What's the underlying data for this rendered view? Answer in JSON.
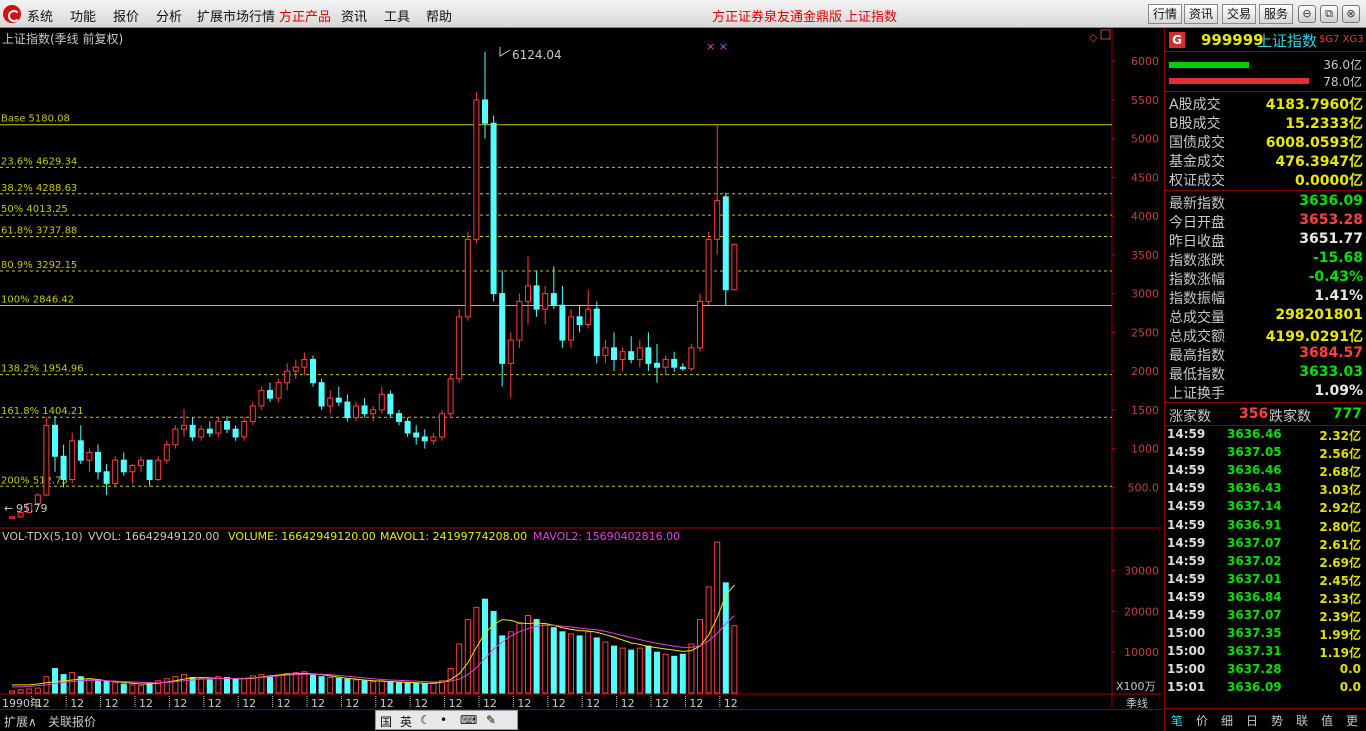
{
  "menu": {
    "items": [
      "系统",
      "功能",
      "报价",
      "分析",
      "扩展市场行情",
      "方正产品",
      "资讯",
      "工具",
      "帮助"
    ],
    "promo1": "方正证券泉友通金鼎版",
    "promo2": "上证指数",
    "right_buttons": [
      "行情",
      "资讯",
      "交易",
      "服务"
    ]
  },
  "chart": {
    "title": "上证指数(季线 前复权)",
    "high_label": "6124.04",
    "low_label": "95.79",
    "marker": "× ×",
    "fib_levels": [
      {
        "label": "Base 5180.08",
        "value": 5180.08,
        "solid": true
      },
      {
        "label": "23.6% 4629.34",
        "value": 4629.34,
        "solid": false
      },
      {
        "label": "38.2% 4288.63",
        "value": 4288.63,
        "solid": false
      },
      {
        "label": "50% 4013.25",
        "value": 4013.25,
        "solid": false
      },
      {
        "label": "61.8% 3737.88",
        "value": 3737.88,
        "solid": false
      },
      {
        "label": "80.9% 3292.15",
        "value": 3292.15,
        "solid": false
      },
      {
        "label": "100% 2846.42",
        "value": 2846.42,
        "solid": true
      },
      {
        "label": "138.2% 1954.96",
        "value": 1954.96,
        "solid": false
      },
      {
        "label": "161.8% 1404.21",
        "value": 1404.21,
        "solid": false
      },
      {
        "label": "200% 512.75",
        "value": 512.75,
        "solid": false
      }
    ],
    "price_ticks": [
      "6000",
      "5500",
      "5000",
      "4500",
      "4000",
      "3500",
      "3000",
      "2500",
      "2000",
      "1500",
      "1000",
      "500.0"
    ],
    "vol_ticks": [
      "30000",
      "20000",
      "10000"
    ],
    "vol_unit": "X100万",
    "x_start_label": "1990年",
    "x_tick_label": "12",
    "period_label": "季线"
  },
  "chart_data": {
    "type": "candlestick",
    "ylim": [
      0,
      6300
    ],
    "vol_ylim": [
      0,
      38000
    ],
    "candles": [
      [
        100,
        120,
        95,
        118,
        5
      ],
      [
        118,
        180,
        115,
        175,
        8
      ],
      [
        175,
        300,
        170,
        290,
        10
      ],
      [
        290,
        420,
        280,
        400,
        12
      ],
      [
        400,
        1400,
        380,
        1300,
        40
      ],
      [
        1300,
        1420,
        700,
        900,
        60
      ],
      [
        900,
        1050,
        500,
        600,
        45
      ],
      [
        600,
        1200,
        550,
        1100,
        50
      ],
      [
        1100,
        1300,
        800,
        850,
        40
      ],
      [
        850,
        1000,
        700,
        950,
        35
      ],
      [
        950,
        1050,
        600,
        700,
        30
      ],
      [
        700,
        800,
        400,
        550,
        28
      ],
      [
        550,
        900,
        500,
        850,
        25
      ],
      [
        850,
        950,
        650,
        700,
        22
      ],
      [
        700,
        800,
        550,
        780,
        20
      ],
      [
        780,
        900,
        700,
        850,
        18
      ],
      [
        850,
        800,
        512,
        600,
        25
      ],
      [
        600,
        900,
        580,
        850,
        30
      ],
      [
        850,
        1100,
        800,
        1050,
        35
      ],
      [
        1050,
        1300,
        1000,
        1250,
        40
      ],
      [
        1250,
        1510,
        1150,
        1300,
        45
      ],
      [
        1300,
        1400,
        1100,
        1150,
        38
      ],
      [
        1150,
        1300,
        1100,
        1250,
        35
      ],
      [
        1250,
        1350,
        1150,
        1200,
        32
      ],
      [
        1200,
        1400,
        1150,
        1350,
        40
      ],
      [
        1350,
        1420,
        1200,
        1250,
        38
      ],
      [
        1250,
        1300,
        1100,
        1150,
        34
      ],
      [
        1150,
        1400,
        1100,
        1350,
        36
      ],
      [
        1350,
        1600,
        1300,
        1550,
        42
      ],
      [
        1550,
        1800,
        1500,
        1750,
        45
      ],
      [
        1750,
        1850,
        1600,
        1650,
        40
      ],
      [
        1650,
        1900,
        1600,
        1850,
        44
      ],
      [
        1850,
        2100,
        1750,
        2000,
        48
      ],
      [
        2000,
        2150,
        1900,
        2050,
        50
      ],
      [
        2050,
        2240,
        1950,
        2150,
        52
      ],
      [
        2150,
        2200,
        1800,
        1850,
        45
      ],
      [
        1850,
        1900,
        1500,
        1550,
        40
      ],
      [
        1550,
        1750,
        1450,
        1650,
        38
      ],
      [
        1650,
        1800,
        1550,
        1600,
        36
      ],
      [
        1600,
        1700,
        1350,
        1400,
        34
      ],
      [
        1400,
        1600,
        1350,
        1550,
        32
      ],
      [
        1550,
        1650,
        1400,
        1450,
        30
      ],
      [
        1450,
        1550,
        1350,
        1500,
        28
      ],
      [
        1500,
        1800,
        1450,
        1700,
        30
      ],
      [
        1700,
        1750,
        1400,
        1450,
        28
      ],
      [
        1450,
        1500,
        1300,
        1350,
        26
      ],
      [
        1350,
        1400,
        1150,
        1200,
        25
      ],
      [
        1200,
        1300,
        1050,
        1150,
        24
      ],
      [
        1150,
        1250,
        1000,
        1100,
        22
      ],
      [
        1100,
        1200,
        1050,
        1150,
        24
      ],
      [
        1150,
        1500,
        1100,
        1450,
        30
      ],
      [
        1450,
        1950,
        1400,
        1900,
        60
      ],
      [
        1900,
        2800,
        1850,
        2700,
        120
      ],
      [
        2700,
        3800,
        2650,
        3700,
        180
      ],
      [
        3700,
        5600,
        3650,
        5500,
        210
      ],
      [
        5500,
        6124,
        5000,
        5200,
        230
      ],
      [
        5200,
        5300,
        2900,
        3000,
        200
      ],
      [
        3000,
        3300,
        1800,
        2100,
        140
      ],
      [
        2100,
        2500,
        1650,
        2400,
        150
      ],
      [
        2400,
        3000,
        2300,
        2900,
        170
      ],
      [
        2900,
        3480,
        2600,
        3100,
        190
      ],
      [
        3100,
        3300,
        2700,
        2800,
        180
      ],
      [
        2800,
        3100,
        2600,
        3000,
        170
      ],
      [
        3000,
        3350,
        2800,
        2850,
        160
      ],
      [
        2850,
        3100,
        2300,
        2400,
        150
      ],
      [
        2400,
        2800,
        2300,
        2700,
        145
      ],
      [
        2700,
        2850,
        2500,
        2600,
        140
      ],
      [
        2600,
        3050,
        2550,
        2800,
        150
      ],
      [
        2800,
        2900,
        2100,
        2200,
        135
      ],
      [
        2200,
        2400,
        2100,
        2300,
        125
      ],
      [
        2300,
        2500,
        2000,
        2150,
        115
      ],
      [
        2150,
        2300,
        2000,
        2250,
        110
      ],
      [
        2250,
        2450,
        2100,
        2150,
        105
      ],
      [
        2150,
        2400,
        2050,
        2300,
        110
      ],
      [
        2300,
        2500,
        2000,
        2100,
        115
      ],
      [
        2100,
        2350,
        1850,
        2050,
        100
      ],
      [
        2050,
        2200,
        1950,
        2150,
        95
      ],
      [
        2150,
        2250,
        1990,
        2050,
        90
      ],
      [
        2050,
        2100,
        2000,
        2030,
        95
      ],
      [
        2030,
        2350,
        2000,
        2300,
        120
      ],
      [
        2300,
        3000,
        2250,
        2900,
        180
      ],
      [
        2900,
        3800,
        2850,
        3700,
        260
      ],
      [
        3700,
        5180,
        3500,
        4200,
        370
      ],
      [
        4250,
        4300,
        2850,
        3050,
        270
      ],
      [
        3050,
        3650,
        3050,
        3636,
        165
      ]
    ],
    "mavol1": [
      20,
      20,
      20,
      22,
      25,
      28,
      30,
      32,
      34,
      35,
      33,
      30,
      28,
      26,
      24,
      22,
      22,
      24,
      27,
      30,
      34,
      37,
      38,
      37,
      36,
      36,
      35,
      35,
      36,
      39,
      42,
      44,
      46,
      47,
      48,
      47,
      45,
      42,
      39,
      36,
      34,
      32,
      30,
      29,
      28,
      27,
      26,
      25,
      24,
      24,
      26,
      33,
      47,
      74,
      112,
      147,
      168,
      180,
      178,
      172,
      170,
      172,
      170,
      166,
      160,
      156,
      153,
      152,
      149,
      143,
      137,
      130,
      123,
      119,
      114,
      111,
      108,
      105,
      102,
      104,
      115,
      142,
      185,
      240,
      265
    ],
    "mavol2": [
      15,
      15,
      16,
      18,
      20,
      23,
      26,
      28,
      30,
      31,
      31,
      30,
      29,
      28,
      27,
      26,
      25,
      25,
      26,
      28,
      30,
      32,
      34,
      35,
      36,
      36,
      36,
      36,
      37,
      38,
      40,
      42,
      44,
      45,
      46,
      46,
      46,
      45,
      43,
      41,
      39,
      37,
      35,
      33,
      32,
      31,
      30,
      29,
      28,
      27,
      27,
      29,
      34,
      45,
      62,
      85,
      107,
      125,
      140,
      150,
      158,
      164,
      166,
      166,
      164,
      162,
      159,
      157,
      155,
      151,
      146,
      141,
      136,
      131,
      126,
      122,
      118,
      115,
      112,
      112,
      116,
      128,
      146,
      170,
      190
    ]
  },
  "legends": {
    "vol_name": "VOL-TDX(5,10)",
    "vvol": "VVOL: 16642949120.00",
    "volume": "VOLUME: 16642949120.00",
    "mavol1": "MAVOL1: 24199774208.00",
    "mavol2": "MAVOL2: 15690402816.00"
  },
  "bottom": {
    "tab1": "扩展∧",
    "tab2": "关联报价",
    "ime": [
      "国",
      "英",
      "☾",
      "•",
      "⌨",
      "✎"
    ]
  },
  "panel": {
    "badge": "G",
    "code": "999999",
    "name": "上证指数",
    "tags": "$G7 XG3",
    "bar1_val": "36.0亿",
    "bar2_val": "78.0亿",
    "volumes": [
      {
        "label": "A股成交",
        "value": "4183.7960亿",
        "color": "#e8e800"
      },
      {
        "label": "B股成交",
        "value": "15.2333亿",
        "color": "#e8e800"
      },
      {
        "label": "国债成交",
        "value": "6008.0593亿",
        "color": "#e8e800"
      },
      {
        "label": "基金成交",
        "value": "476.3947亿",
        "color": "#e8e800"
      },
      {
        "label": "权证成交",
        "value": "0.0000亿",
        "color": "#e8e800"
      }
    ],
    "stats": [
      {
        "label": "最新指数",
        "value": "3636.09",
        "color": "#00e000"
      },
      {
        "label": "今日开盘",
        "value": "3653.28",
        "color": "#ff4040"
      },
      {
        "label": "昨日收盘",
        "value": "3651.77",
        "color": "#e8e8e8"
      },
      {
        "label": "指数涨跌",
        "value": "-15.68",
        "color": "#00e000"
      },
      {
        "label": "指数涨幅",
        "value": "-0.43%",
        "color": "#00e000"
      },
      {
        "label": "指数振幅",
        "value": "1.41%",
        "color": "#e8e8e8"
      },
      {
        "label": "总成交量",
        "value": "298201801",
        "color": "#e8e800"
      },
      {
        "label": "总成交额",
        "value": "4199.0291亿",
        "color": "#e8e800"
      },
      {
        "label": "最高指数",
        "value": "3684.57",
        "color": "#ff4040"
      },
      {
        "label": "最低指数",
        "value": "3633.03",
        "color": "#00e000"
      },
      {
        "label": "上证换手",
        "value": "1.09%",
        "color": "#e8e8e8"
      }
    ],
    "up_label": "涨家数",
    "up_value": "356",
    "down_label": "跌家数",
    "down_value": "777",
    "ticks": [
      {
        "time": "14:59",
        "price": "3636.46",
        "vol": "2.32亿"
      },
      {
        "time": "14:59",
        "price": "3637.05",
        "vol": "2.56亿"
      },
      {
        "time": "14:59",
        "price": "3636.46",
        "vol": "2.68亿"
      },
      {
        "time": "14:59",
        "price": "3636.43",
        "vol": "3.03亿"
      },
      {
        "time": "14:59",
        "price": "3637.14",
        "vol": "2.92亿"
      },
      {
        "time": "14:59",
        "price": "3636.91",
        "vol": "2.80亿"
      },
      {
        "time": "14:59",
        "price": "3637.07",
        "vol": "2.61亿"
      },
      {
        "time": "14:59",
        "price": "3637.02",
        "vol": "2.69亿"
      },
      {
        "time": "14:59",
        "price": "3637.01",
        "vol": "2.45亿"
      },
      {
        "time": "14:59",
        "price": "3636.84",
        "vol": "2.33亿"
      },
      {
        "time": "14:59",
        "price": "3637.07",
        "vol": "2.39亿"
      },
      {
        "time": "15:00",
        "price": "3637.35",
        "vol": "1.99亿"
      },
      {
        "time": "15:00",
        "price": "3637.31",
        "vol": "1.19亿"
      },
      {
        "time": "15:00",
        "price": "3637.28",
        "vol": "0.0"
      },
      {
        "time": "15:01",
        "price": "3636.09",
        "vol": "0.0"
      }
    ],
    "tabs": [
      "笔",
      "价",
      "细",
      "日",
      "势",
      "联",
      "值",
      "更"
    ]
  }
}
